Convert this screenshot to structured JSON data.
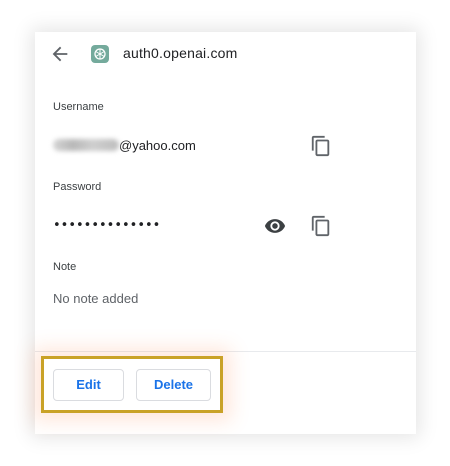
{
  "header": {
    "site": "auth0.openai.com",
    "back_icon": "arrow-left-icon",
    "site_icon": "openai-logo-icon"
  },
  "username": {
    "label": "Username",
    "value_visible": "@yahoo.com",
    "copy_icon": "copy-icon"
  },
  "password": {
    "label": "Password",
    "masked": "••••••••••••••",
    "show_icon": "eye-icon",
    "copy_icon": "copy-icon"
  },
  "note": {
    "label": "Note",
    "value": "No note added"
  },
  "actions": {
    "edit_label": "Edit",
    "delete_label": "Delete"
  },
  "colors": {
    "accent": "#1a73e8",
    "highlight_border": "#c9a227",
    "text_primary": "#202124",
    "text_secondary": "#5f6368"
  }
}
